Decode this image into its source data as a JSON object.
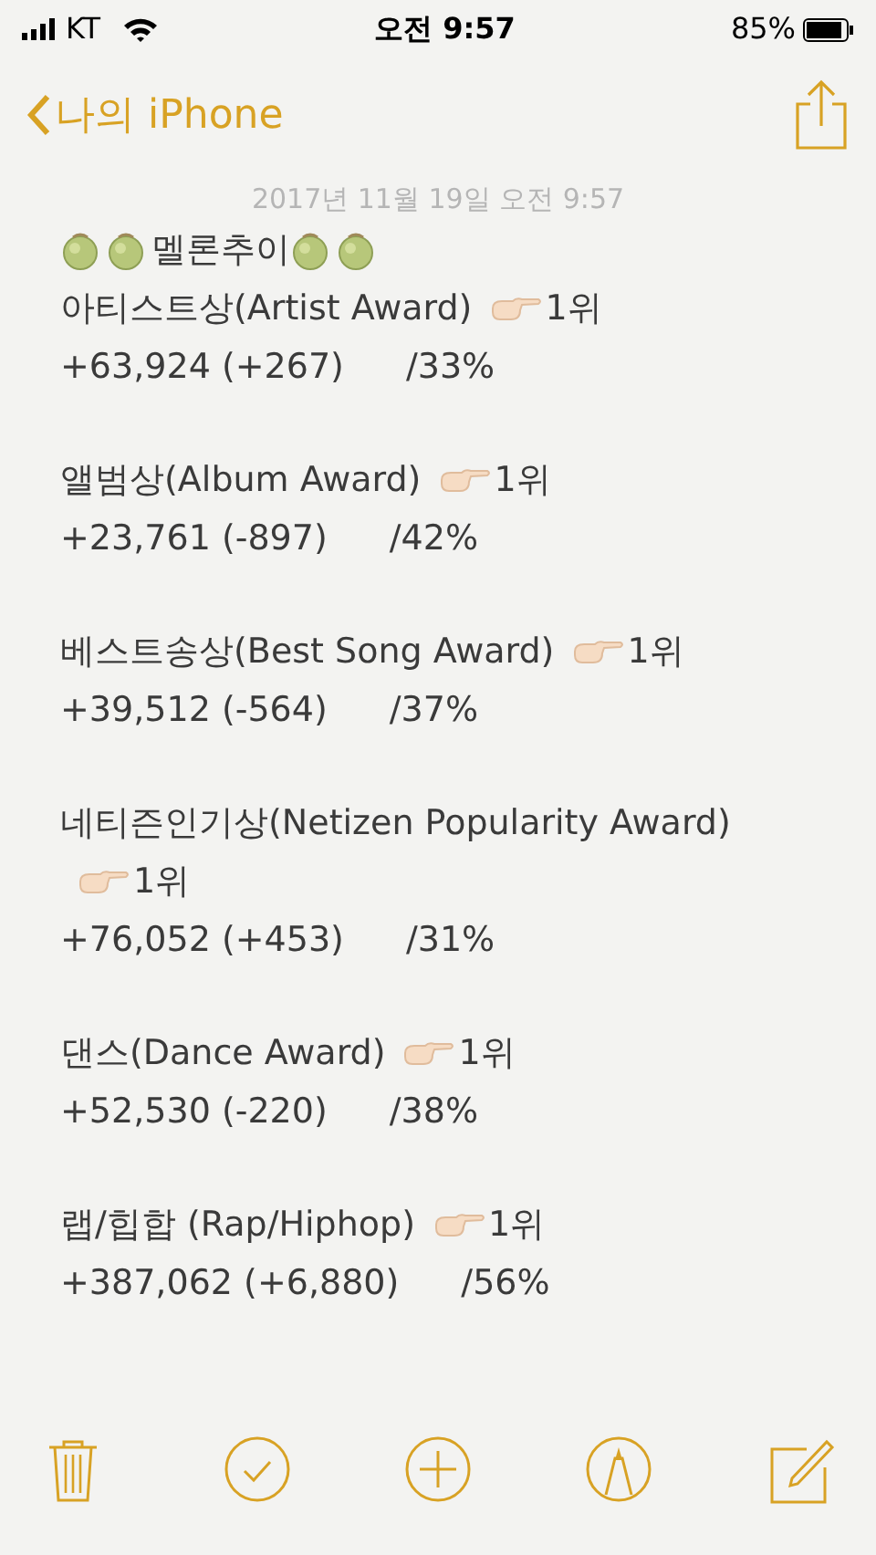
{
  "status_bar": {
    "carrier": "KT",
    "time": "오전 9:57",
    "battery": "85%"
  },
  "nav": {
    "back": "나의 iPhone"
  },
  "note": {
    "date": "2017년 11월 19일 오전 9:57",
    "heading": [
      {
        "kind": "melon"
      },
      {
        "kind": "melon"
      },
      {
        "kind": "text",
        "text": "멜론추이"
      },
      {
        "kind": "melon"
      },
      {
        "kind": "melon"
      }
    ],
    "awards": [
      {
        "title": "아티스트상(Artist Award)",
        "rank": "1위",
        "stats": "+63,924 (+267)",
        "share": "/33%"
      },
      {
        "title": "앨범상(Album Award)",
        "rank": "1위",
        "stats": "+23,761 (-897)",
        "share": "/42%"
      },
      {
        "title": "베스트송상(Best Song Award)",
        "rank": "1위",
        "stats": "+39,512 (-564)",
        "share": "/37%"
      },
      {
        "title": "네티즌인기상(Netizen Popularity Award)",
        "rank": "1위",
        "stats": "+76,052 (+453)",
        "share": "/31%"
      },
      {
        "title": "댄스(Dance Award)",
        "rank": "1위",
        "stats": "+52,530 (-220)",
        "share": "/38%"
      },
      {
        "title": "랩/힙합 (Rap/Hiphop)",
        "rank": "1위",
        "stats": "+387,062 (+6,880)",
        "share": "/56%"
      }
    ]
  },
  "toolbar": [
    {
      "kind": "trash"
    },
    {
      "kind": "check"
    },
    {
      "kind": "plus"
    },
    {
      "kind": "markup"
    },
    {
      "kind": "compose"
    }
  ]
}
